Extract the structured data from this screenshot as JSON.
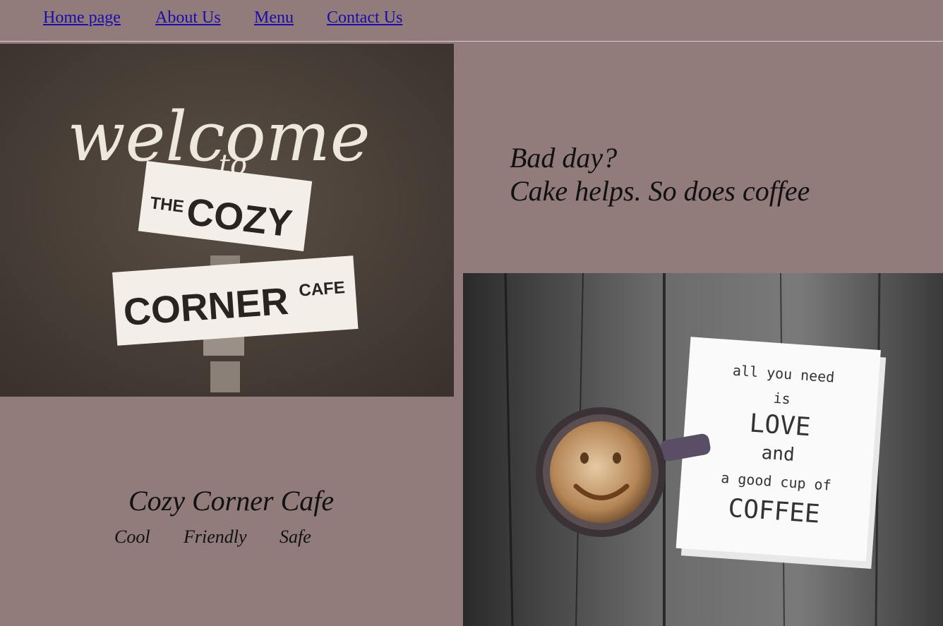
{
  "nav": {
    "items": [
      {
        "label": "Home page"
      },
      {
        "label": "About Us"
      },
      {
        "label": "Menu"
      },
      {
        "label": "Contact Us"
      }
    ],
    "link_color": "#1a0dab"
  },
  "hero_image": {
    "script_text": "welcome",
    "to_text": "to",
    "sign_top_small": "THE",
    "sign_top_big": "COZY",
    "sign_bottom_big": "CORNER",
    "sign_bottom_small": "CAFE"
  },
  "tagline": {
    "line1": "Bad day?",
    "line2": "Cake helps. So does coffee"
  },
  "cafe": {
    "name": "Cozy Corner Cafe",
    "traits": [
      "Cool",
      "Friendly",
      "Safe"
    ]
  },
  "coffee_image": {
    "note_line1": "all you need",
    "note_line2": "is",
    "note_line3": "LOVE",
    "note_line4": "and",
    "note_line5": "a good cup of",
    "note_line6": "COFFEE"
  },
  "colors": {
    "background": "#917b7b",
    "chalkboard": "#4a4038",
    "wood": "#5a5a5a"
  }
}
